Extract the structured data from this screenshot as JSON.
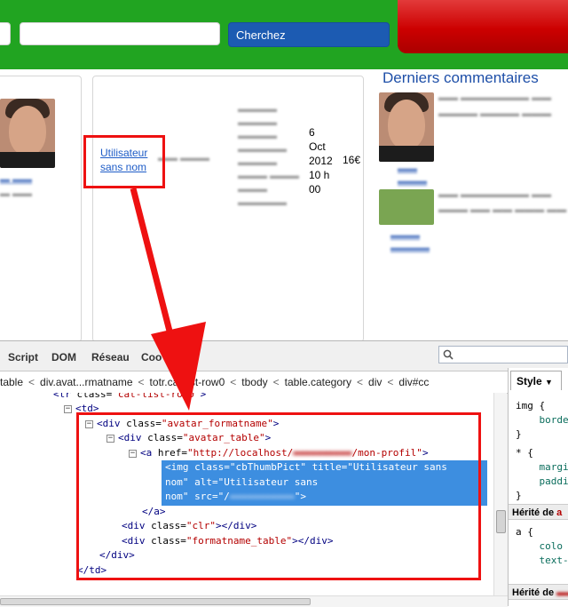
{
  "header": {
    "search_input_1": "",
    "search_input_2": "",
    "search_button_label": "Cherchez"
  },
  "listing": {
    "user_link_line1": "Utilisateur",
    "user_link_line2": "sans nom",
    "date_lines": [
      "6",
      "Oct",
      "2012",
      "10 h",
      "00"
    ],
    "price": "16€"
  },
  "sidebar": {
    "comments_title": "Derniers commentaires"
  },
  "devtools": {
    "tabs": [
      "Script",
      "DOM",
      "Réseau",
      "Coo"
    ],
    "breadcrumb": [
      "table",
      "div.avat...rmatname",
      "to",
      "tr.cat-list-row0",
      "tbody",
      "table.category",
      "div",
      "div#cc"
    ],
    "code": {
      "l0_open": "<",
      "l0_tag": "tr",
      "l0_attr": " class=",
      "l0_val": "\"cat-list-row0\"",
      "l0_close": ">",
      "l1": "<td>",
      "l2_tag_open": "<div",
      "l2_attr": " class=",
      "l2_val": "\"avatar_formatname\"",
      "l2_close": ">",
      "l3_tag_open": "<div",
      "l3_attr": " class=",
      "l3_val": "\"avatar_table\"",
      "l3_close": ">",
      "l4_tag_open": "<a",
      "l4_attr": " href=",
      "l4_val_a": "\"http://localhost/",
      "l4_val_b": "/mon-profil\"",
      "l4_close": ">",
      "l5": "<img class=\"cbThumbPict\" title=\"Utilisateur sans",
      "l6": "nom\" alt=\"Utilisateur sans",
      "l7_a": "nom\" src=\"/",
      "l7_b": "\">",
      "l8": "</a>",
      "l9_tag_open": "<div",
      "l9_attr": " class=",
      "l9_val": "\"clr\"",
      "l9_close": "></div>",
      "l10_tag_open": "<div",
      "l10_attr": " class=",
      "l10_val": "\"formatname_table\"",
      "l10_close": "></div>",
      "l11": "</div>",
      "l12": "</td>"
    },
    "style_panel": {
      "tab_label": "Style",
      "rules": [
        "img {",
        "    borde",
        "}",
        "* {",
        "    margi",
        "    paddi",
        "}",
        "a {",
        "    colo",
        "    text-"
      ],
      "inherited_from_1": "Hérité de",
      "inherited_tag_1": "a",
      "inherited_from_2": "Hérité de"
    }
  },
  "colors": {
    "header_green": "#21a421",
    "search_button_blue": "#1c5bb2",
    "annotation_red": "#ee1111",
    "selection_blue": "#3d8ee0"
  }
}
